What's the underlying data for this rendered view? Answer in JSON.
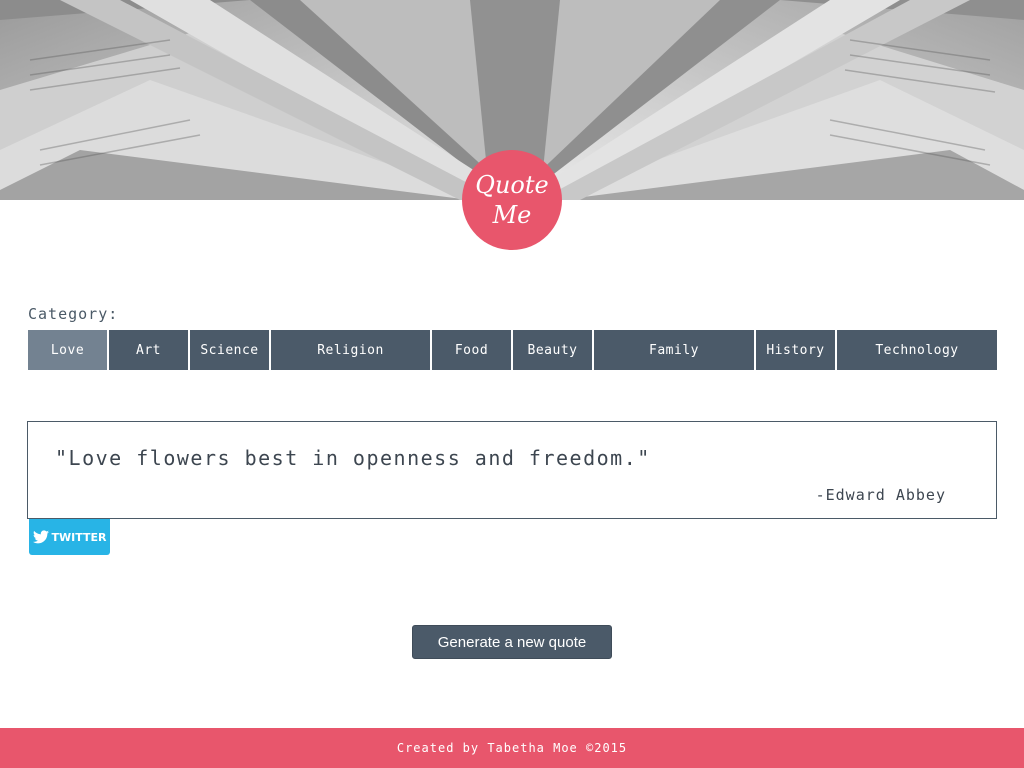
{
  "header": {
    "hero_image": "open-book-photo",
    "logo": {
      "line1": "Quote",
      "line2": "Me"
    }
  },
  "category": {
    "label": "Category:",
    "items": [
      {
        "label": "Love",
        "active": true
      },
      {
        "label": "Art",
        "active": false
      },
      {
        "label": "Science",
        "active": false
      },
      {
        "label": "Religion",
        "active": false
      },
      {
        "label": "Food",
        "active": false
      },
      {
        "label": "Beauty",
        "active": false
      },
      {
        "label": "Family",
        "active": false
      },
      {
        "label": "History",
        "active": false
      },
      {
        "label": "Technology",
        "active": false
      }
    ]
  },
  "quote": {
    "text": "\"Love flowers best in openness and freedom.\"",
    "author": "-Edward Abbey"
  },
  "twitter": {
    "label": "TWITTER",
    "icon": "twitter-bird-icon"
  },
  "generate": {
    "label": "Generate a new quote"
  },
  "footer": {
    "text": "Created by Tabetha Moe ©2015"
  },
  "colors": {
    "accent": "#e8566c",
    "nav": "#4b5a69",
    "nav_active": "#738291",
    "twitter": "#28b4e6"
  }
}
